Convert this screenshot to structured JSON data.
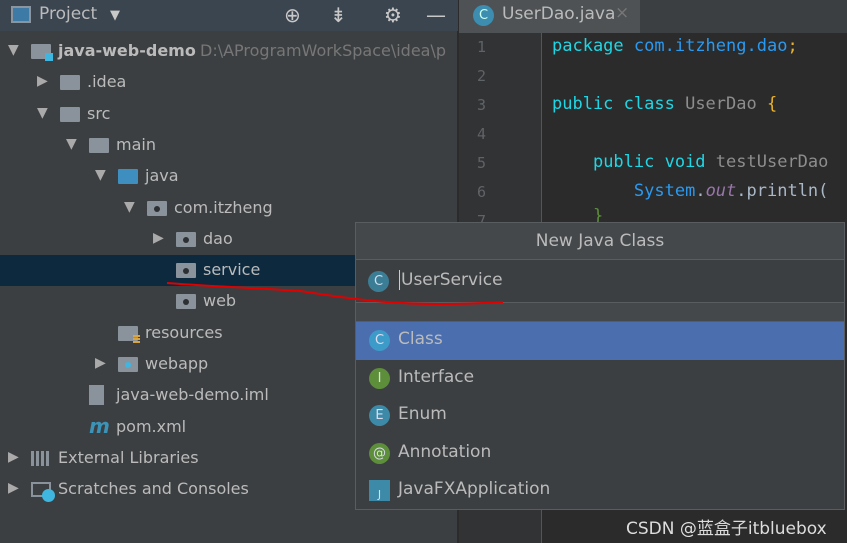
{
  "project_panel": {
    "title": "Project",
    "buttons": [
      "locate-icon",
      "collapse-all-icon",
      "gear-icon",
      "minimize-icon"
    ]
  },
  "tree": [
    {
      "label": "java-web-demo",
      "path": "D:\\AProgramWorkSpace\\idea\\p",
      "level": 0,
      "arrow": "down",
      "icon": "module",
      "bold": true
    },
    {
      "label": ".idea",
      "level": 1,
      "arrow": "right",
      "icon": "folder"
    },
    {
      "label": "src",
      "level": 1,
      "arrow": "down",
      "icon": "folder"
    },
    {
      "label": "main",
      "level": 2,
      "arrow": "down",
      "icon": "folder"
    },
    {
      "label": "java",
      "level": 3,
      "arrow": "down",
      "icon": "source-folder"
    },
    {
      "label": "com.itzheng",
      "level": 4,
      "arrow": "down",
      "icon": "package"
    },
    {
      "label": "dao",
      "level": 5,
      "arrow": "right",
      "icon": "package"
    },
    {
      "label": "service",
      "level": 5,
      "arrow": "",
      "icon": "package",
      "selected": true
    },
    {
      "label": "web",
      "level": 5,
      "arrow": "",
      "icon": "package"
    },
    {
      "label": "resources",
      "level": 3,
      "arrow": "",
      "icon": "resources-folder"
    },
    {
      "label": "webapp",
      "level": 3,
      "arrow": "right",
      "icon": "web-folder"
    },
    {
      "label": "java-web-demo.iml",
      "level": 2,
      "arrow": "",
      "icon": "iml-file"
    },
    {
      "label": "pom.xml",
      "level": 2,
      "arrow": "",
      "icon": "maven"
    },
    {
      "label": "External Libraries",
      "level": 0,
      "arrow": "right",
      "icon": "libraries"
    },
    {
      "label": "Scratches and Consoles",
      "level": 0,
      "arrow": "right",
      "icon": "scratches"
    }
  ],
  "editor": {
    "tab": "UserDao.java",
    "line_numbers": [
      "1",
      "2",
      "3",
      "4",
      "5",
      "6",
      "7"
    ]
  },
  "code": {
    "l1": {
      "kw": "package",
      "pkg": "com.itzheng.dao",
      "semi": ";"
    },
    "l3": {
      "kw": "public class",
      "name": "UserDao",
      "brace": "{"
    },
    "l5": {
      "kw": "public void",
      "name": "testUserDao"
    },
    "l6": {
      "cls": "System",
      "dot1": ".",
      "field": "out",
      "rest": ".println("
    },
    "l7": {
      "brace": "}"
    }
  },
  "dialog": {
    "title": "New Java Class",
    "input_value": "UserService",
    "kinds": [
      {
        "label": "Class",
        "badge": "C",
        "color": "#3d9bc9",
        "selected": true
      },
      {
        "label": "Interface",
        "badge": "I",
        "color": "#5d8f3a"
      },
      {
        "label": "Enum",
        "badge": "E",
        "color": "#3d8aa8"
      },
      {
        "label": "Annotation",
        "badge": "@",
        "color": "#5d8f3a"
      },
      {
        "label": "JavaFXApplication",
        "badge": "J",
        "color": "#3d8aa8"
      }
    ]
  },
  "watermark": "CSDN @蓝盒子itbluebox",
  "colors": {
    "selection": "#4b6eaf",
    "tree_selection": "#0d293e",
    "annotation_stroke": "#e00000"
  }
}
